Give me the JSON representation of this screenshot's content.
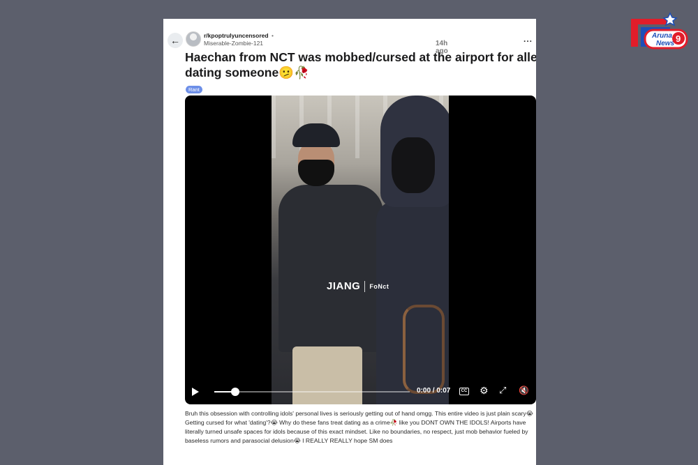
{
  "post": {
    "subreddit": "r/kpoptrulyuncensored",
    "separator": "•",
    "time": "14h ago",
    "username": "Miserable-Zombie-121",
    "more_label": "...",
    "title_line1": "Haechan from NCT was mobbed/cursed at the airport for allegedly",
    "title_line2": "dating someone🫤🥀",
    "flair": "Rant",
    "body": "Bruh this obsession with controlling idols' personal lives is seriously getting out of hand omgg. This entire video is just plain scary😭 Getting cursed for what 'dating'?😭 Why do these fans treat dating as a crime🥀 like you DONT OWN THE IDOLS! Airports have literally turned unsafe spaces for idols because of this exact mindset. Like no boundaries, no respect, just mob behavior fueled by baseless rumors and parasocial delusion😭 I REALLY REALLY hope SM does"
  },
  "video": {
    "watermark_main": "JIANG",
    "watermark_sub": "FoNct",
    "time_display": "0:00 / 0:07",
    "cc_label": "CC",
    "progress": 0.05
  },
  "logo": {
    "line1": "Aruna",
    "line2": "News",
    "digit": "9",
    "colors": {
      "red": "#e11d2a",
      "blue": "#1d4fb8",
      "white": "#ffffff"
    }
  },
  "icons": {
    "back": "arrow-left-icon",
    "play": "play-icon",
    "settings": "gear-icon",
    "fullscreen": "expand-icon",
    "mute": "volume-mute-icon"
  }
}
